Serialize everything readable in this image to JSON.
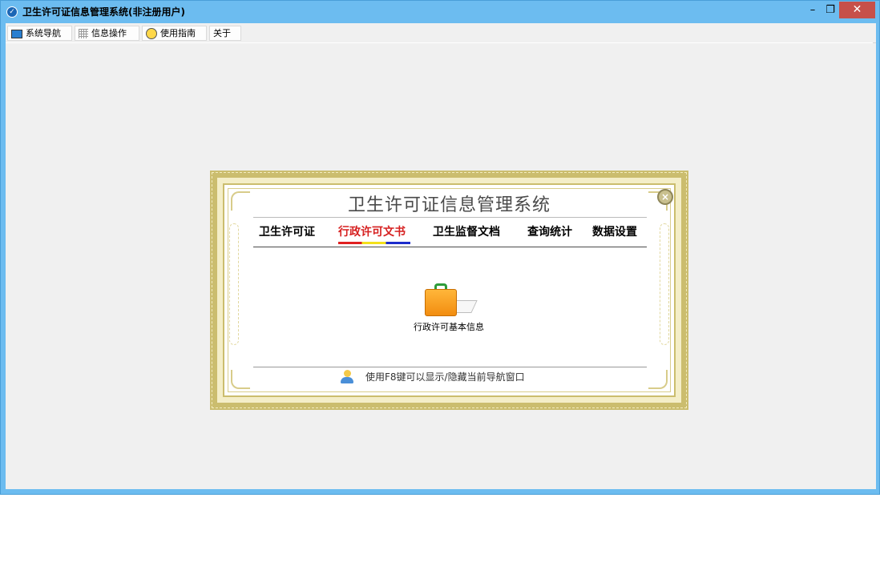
{
  "window": {
    "title": "卫生许可证信息管理系统(非注册用户)",
    "controls": {
      "minimize": "–",
      "restore": "❐",
      "close": "✕"
    }
  },
  "menu": {
    "items": [
      {
        "label": "系统导航",
        "icon": "monitor-icon"
      },
      {
        "label": "信息操作",
        "icon": "grid-icon"
      },
      {
        "label": "使用指南",
        "icon": "clock-icon"
      },
      {
        "label": "关于"
      }
    ]
  },
  "panel": {
    "title": "卫生许可证信息管理系统",
    "close_glyph": "×",
    "tabs": [
      {
        "label": "卫生许可证"
      },
      {
        "label": "行政许可文书",
        "active": true
      },
      {
        "label": "卫生监督文档"
      },
      {
        "label": "查询统计"
      },
      {
        "label": "数据设置"
      }
    ],
    "shortcut": {
      "label": "行政许可基本信息",
      "icon": "briefcase-icon"
    },
    "tip": {
      "text": "使用F8键可以显示/隐藏当前导航窗口",
      "icon": "user-icon"
    }
  },
  "colors": {
    "titlebar": "#6cbcf0",
    "close_button": "#c7504a",
    "client_bg": "#f0f0f0",
    "frame_gold": "#cbbd6e",
    "active_tab": "#d62020"
  }
}
